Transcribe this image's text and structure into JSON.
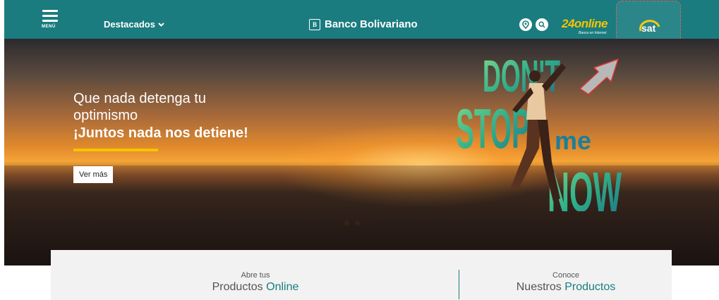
{
  "header": {
    "menu_label": "MENÚ",
    "featured_label": "Destacados",
    "brand_name": "Banco Bolivariano",
    "brand_mark": "B",
    "online_label": "24online",
    "online_sub": "Banca en Internet",
    "sat_label": "sat",
    "icons": [
      "location-icon",
      "search-icon"
    ]
  },
  "hero": {
    "line1": "Que nada detenga tu",
    "line2": "optimismo",
    "line3": "¡Juntos nada nos detiene!",
    "cta_label": "Ver más",
    "poster_words": [
      "DON'T",
      "STOP",
      "me",
      "NOW"
    ],
    "slide_count": 3,
    "active_slide": 3
  },
  "products": {
    "left": {
      "pre": "Abre tus",
      "title_plain": "Productos",
      "title_highlight": "Online"
    },
    "right": {
      "pre": "Conoce",
      "title_plain": "Nuestros",
      "title_highlight": "Productos"
    }
  },
  "colors": {
    "brand_teal": "#1a7c7f",
    "accent_yellow": "#f5c400"
  }
}
